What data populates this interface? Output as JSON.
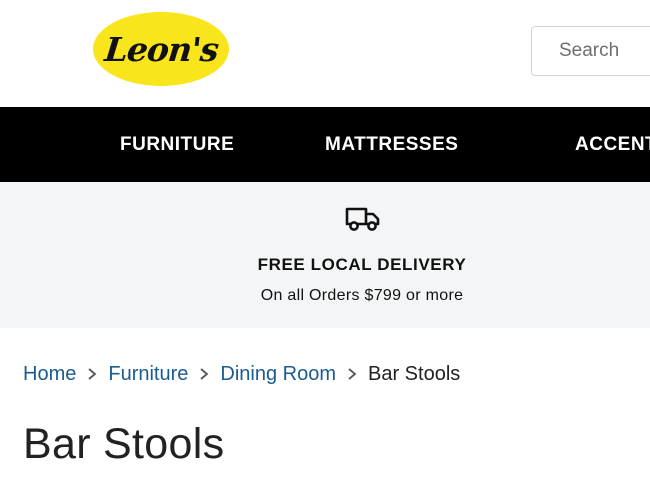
{
  "header": {
    "logo_text": "Leon's",
    "search_placeholder": "Search",
    "brand_color": "#f9e51c"
  },
  "nav": {
    "items": [
      {
        "label": "FURNITURE"
      },
      {
        "label": "MATTRESSES"
      },
      {
        "label": "ACCENTS"
      }
    ]
  },
  "promo": {
    "icon": "truck-icon",
    "title": "FREE LOCAL DELIVERY",
    "subtitle": "On all Orders $799 or more"
  },
  "breadcrumb": {
    "items": [
      {
        "label": "Home"
      },
      {
        "label": "Furniture"
      },
      {
        "label": "Dining Room"
      }
    ],
    "current": "Bar Stools"
  },
  "page": {
    "title": "Bar Stools"
  },
  "colors": {
    "nav_bg": "#000000",
    "promo_bg": "#f4f5f6",
    "link": "#1b5c8e"
  }
}
